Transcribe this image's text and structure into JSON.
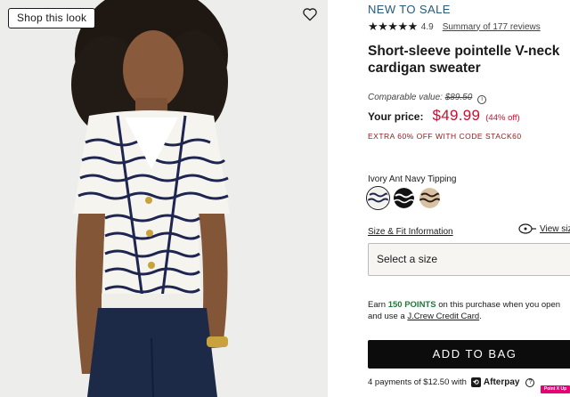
{
  "media": {
    "shop_look_label": "Shop this look",
    "favorite_icon": "heart-icon"
  },
  "product": {
    "promo": "NEW TO SALE",
    "stars": "★★★★★",
    "rating": "4.9",
    "reviews_link": "Summary of 177 reviews",
    "title": "Short-sleeve pointelle V-neck cardigan sweater",
    "comparable_label": "Comparable value:",
    "comparable_price": "$89.50",
    "price_label": "Your price:",
    "price": "$49.99",
    "discount": "(44% off)",
    "promo_code": "EXTRA 60% OFF WITH CODE STACK60"
  },
  "color": {
    "label": "Ivory Ant Navy Tipping",
    "swatches": [
      {
        "name": "ivory-navy-stripe",
        "selected": true
      },
      {
        "name": "black-white-stripe",
        "selected": false
      },
      {
        "name": "tan-black-pattern",
        "selected": false
      }
    ]
  },
  "size": {
    "fit_link": "Size & Fit Information",
    "view_size": "View siz",
    "select_placeholder": "Select a size"
  },
  "rewards": {
    "earn_prefix": "Earn ",
    "points": "150 POINTS",
    "earn_middle": " on this purchase when you open and use a ",
    "card_link": "J.Crew Credit Card",
    "earn_suffix": "."
  },
  "cart": {
    "add_to_bag": "ADD TO BAG"
  },
  "afterpay": {
    "text": "4 payments of $12.50 with",
    "brand": "Afterpay",
    "help": "?"
  },
  "badge": {
    "label": "Point X Up"
  },
  "colors": {
    "price_red": "#c8102e",
    "promo_blue": "#255a7a",
    "points_green": "#1f7a3a",
    "button_black": "#0c0c0c"
  }
}
